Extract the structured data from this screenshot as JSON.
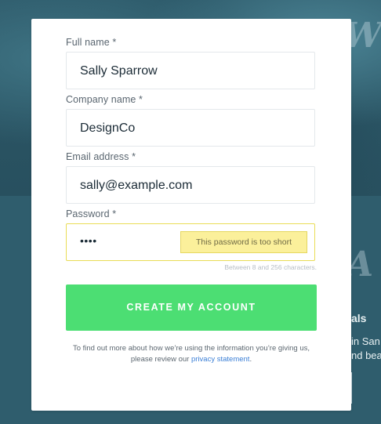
{
  "background": {
    "heading": "als",
    "line1": "in San",
    "line2": "nd beau"
  },
  "form": {
    "full_name": {
      "label": "Full name *",
      "value": "Sally Sparrow"
    },
    "company": {
      "label": "Company name *",
      "value": "DesignCo"
    },
    "email": {
      "label": "Email address *",
      "value": "sally@example.com"
    },
    "password": {
      "label": "Password *",
      "value": "••••",
      "error": "This password is too short",
      "hint": "Between 8 and 256 characters."
    },
    "submit_label": "CREATE MY ACCOUNT",
    "footnote": {
      "text_line1": "To find out more about how we’re using the information you’re giving us,",
      "text_line2": "please review our ",
      "link_text": "privacy statement",
      "text_end": "."
    }
  },
  "colors": {
    "accent_green": "#4cde73",
    "error_yellow": "#fbf09b",
    "link_blue": "#3b7fd6"
  }
}
